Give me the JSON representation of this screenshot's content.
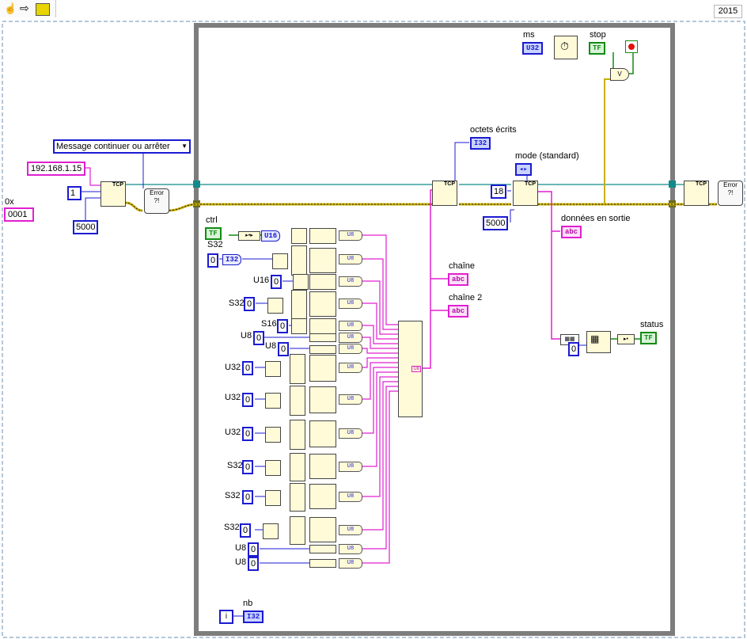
{
  "toolbar": {
    "hand_icon": "hand-icon",
    "arrow_icon": "arrow-icon",
    "run_icon": "run-icon"
  },
  "version": "2015",
  "labels": {
    "hex_prefix": "0x",
    "ms": "ms",
    "stop": "stop",
    "octets": "octets écrits",
    "mode": "mode (standard)",
    "donnees": "données en sortie",
    "chaine": "chaîne",
    "chaine2": "chaîne 2",
    "status": "status",
    "ctrl": "ctrl",
    "s32_top": "S32",
    "u16": "U16",
    "s32_a": "S32",
    "s16": "S16",
    "u8_a": "U8",
    "u8_b": "U8",
    "u32_a": "U32",
    "u32_b": "U32",
    "u32_c": "U32",
    "s32_b": "S32",
    "s32_c": "S32",
    "s32_d": "S32",
    "u8_c": "U8",
    "u8_d": "U8",
    "nb": "nb"
  },
  "constants": {
    "hex_value": "0001",
    "ip": "192.168.1.15",
    "port": "1",
    "timeout1": "5000",
    "timeout2": "5000",
    "bytes": "18",
    "zero": "0",
    "iter": "i"
  },
  "enum": {
    "selected": "Message continuer ou arrêter"
  },
  "terms": {
    "i32": "I32",
    "u32": "U32",
    "u16": "U16",
    "tf": "TF",
    "abc": "abc",
    "u8": "U8"
  },
  "colors": {
    "int_wire": "#1b1bd1",
    "str_wire": "#e020d0",
    "bool_wire": "#128c12",
    "err_wire": "#c9b000",
    "ref_wire": "#138a8a",
    "loop": "#7d7d7d"
  }
}
